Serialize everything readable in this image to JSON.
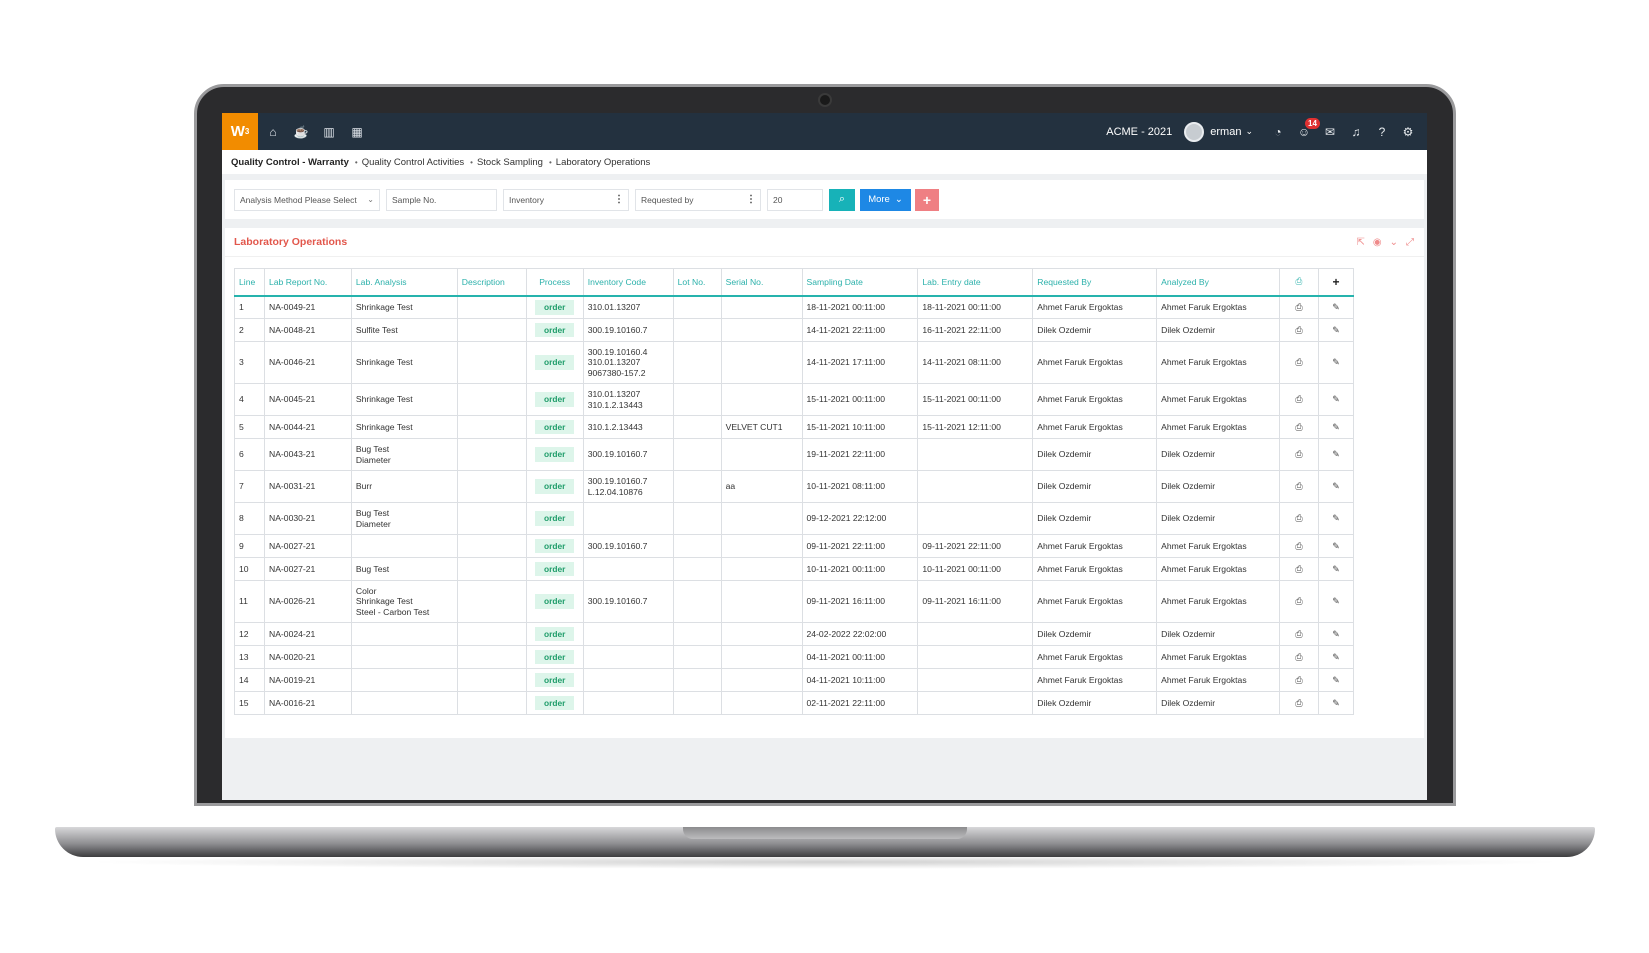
{
  "topbar": {
    "logo": "W",
    "logo_sup": "3",
    "company": "ACME - 2021",
    "username": "erman",
    "notification_count": "14"
  },
  "breadcrumb": [
    "Quality Control - Warranty",
    "Quality Control Activities",
    "Stock Sampling",
    "Laboratory Operations"
  ],
  "filters": {
    "analysis_method": "Analysis Method Please Select",
    "sample_no": "Sample No.",
    "inventory": "Inventory",
    "requested_by": "Requested by",
    "page_size": "20",
    "more_label": "More",
    "add_label": "+"
  },
  "panel": {
    "title": "Laboratory Operations"
  },
  "table": {
    "headers": [
      "Line",
      "Lab Report No.",
      "Lab. Analysis",
      "Description",
      "Process",
      "Inventory Code",
      "Lot No.",
      "Serial No.",
      "Sampling Date",
      "Lab. Entry date",
      "Requested By",
      "Analyzed By",
      "",
      "+"
    ],
    "rows": [
      {
        "line": "1",
        "report": "NA-0049-21",
        "analysis": [
          "Shrinkage Test"
        ],
        "desc": "",
        "process": "order",
        "inv": [
          "310.01.13207"
        ],
        "lot": "",
        "serial": "",
        "sampling": "18-11-2021 00:11:00",
        "entry": "18-11-2021 00:11:00",
        "req": "Ahmet Faruk Ergoktas",
        "ana": "Ahmet Faruk Ergoktas"
      },
      {
        "line": "2",
        "report": "NA-0048-21",
        "analysis": [
          "Sulfite Test"
        ],
        "desc": "",
        "process": "order",
        "inv": [
          "300.19.10160.7"
        ],
        "lot": "",
        "serial": "",
        "sampling": "14-11-2021 22:11:00",
        "entry": "16-11-2021 22:11:00",
        "req": "Dilek Ozdemir",
        "ana": "Dilek Ozdemir"
      },
      {
        "line": "3",
        "report": "NA-0046-21",
        "analysis": [
          "Shrinkage Test"
        ],
        "desc": "",
        "process": "order",
        "inv": [
          "300.19.10160.4",
          "310.01.13207",
          "9067380-157.2"
        ],
        "lot": "",
        "serial": "",
        "sampling": "14-11-2021 17:11:00",
        "entry": "14-11-2021 08:11:00",
        "req": "Ahmet Faruk Ergoktas",
        "ana": "Ahmet Faruk Ergoktas"
      },
      {
        "line": "4",
        "report": "NA-0045-21",
        "analysis": [
          "Shrinkage Test"
        ],
        "desc": "",
        "process": "order",
        "inv": [
          "310.01.13207",
          "310.1.2.13443"
        ],
        "lot": "",
        "serial": "",
        "sampling": "15-11-2021 00:11:00",
        "entry": "15-11-2021 00:11:00",
        "req": "Ahmet Faruk Ergoktas",
        "ana": "Ahmet Faruk Ergoktas"
      },
      {
        "line": "5",
        "report": "NA-0044-21",
        "analysis": [
          "Shrinkage Test"
        ],
        "desc": "",
        "process": "order",
        "inv": [
          "310.1.2.13443"
        ],
        "lot": "",
        "serial": "VELVET CUT1",
        "sampling": "15-11-2021 10:11:00",
        "entry": "15-11-2021 12:11:00",
        "req": "Ahmet Faruk Ergoktas",
        "ana": "Ahmet Faruk Ergoktas"
      },
      {
        "line": "6",
        "report": "NA-0043-21",
        "analysis": [
          "Bug Test",
          "Diameter"
        ],
        "desc": "",
        "process": "order",
        "inv": [
          "300.19.10160.7"
        ],
        "lot": "",
        "serial": "",
        "sampling": "19-11-2021 22:11:00",
        "entry": "",
        "req": "Dilek Ozdemir",
        "ana": "Dilek Ozdemir"
      },
      {
        "line": "7",
        "report": "NA-0031-21",
        "analysis": [
          "Burr"
        ],
        "desc": "",
        "process": "order",
        "inv": [
          "300.19.10160.7",
          "L.12.04.10876"
        ],
        "lot": "",
        "serial": "aa",
        "sampling": "10-11-2021 08:11:00",
        "entry": "",
        "req": "Dilek Ozdemir",
        "ana": "Dilek Ozdemir"
      },
      {
        "line": "8",
        "report": "NA-0030-21",
        "analysis": [
          "Bug Test",
          "Diameter"
        ],
        "desc": "",
        "process": "order",
        "inv": [],
        "lot": "",
        "serial": "",
        "sampling": "09-12-2021 22:12:00",
        "entry": "",
        "req": "Dilek Ozdemir",
        "ana": "Dilek Ozdemir"
      },
      {
        "line": "9",
        "report": "NA-0027-21",
        "analysis": [],
        "desc": "",
        "process": "order",
        "inv": [
          "300.19.10160.7"
        ],
        "lot": "",
        "serial": "",
        "sampling": "09-11-2021 22:11:00",
        "entry": "09-11-2021 22:11:00",
        "req": "Ahmet Faruk Ergoktas",
        "ana": "Ahmet Faruk Ergoktas"
      },
      {
        "line": "10",
        "report": "NA-0027-21",
        "analysis": [
          "Bug Test"
        ],
        "desc": "",
        "process": "order",
        "inv": [],
        "lot": "",
        "serial": "",
        "sampling": "10-11-2021 00:11:00",
        "entry": "10-11-2021 00:11:00",
        "req": "Ahmet Faruk Ergoktas",
        "ana": "Ahmet Faruk Ergoktas"
      },
      {
        "line": "11",
        "report": "NA-0026-21",
        "analysis": [
          "Color",
          "Shrinkage Test",
          "Steel - Carbon Test"
        ],
        "desc": "",
        "process": "order",
        "inv": [
          "300.19.10160.7"
        ],
        "lot": "",
        "serial": "",
        "sampling": "09-11-2021 16:11:00",
        "entry": "09-11-2021 16:11:00",
        "req": "Ahmet Faruk Ergoktas",
        "ana": "Ahmet Faruk Ergoktas"
      },
      {
        "line": "12",
        "report": "NA-0024-21",
        "analysis": [],
        "desc": "",
        "process": "order",
        "inv": [],
        "lot": "",
        "serial": "",
        "sampling": "24-02-2022 22:02:00",
        "entry": "",
        "req": "Dilek Ozdemir",
        "ana": "Dilek Ozdemir"
      },
      {
        "line": "13",
        "report": "NA-0020-21",
        "analysis": [],
        "desc": "",
        "process": "order",
        "inv": [],
        "lot": "",
        "serial": "",
        "sampling": "04-11-2021 00:11:00",
        "entry": "",
        "req": "Ahmet Faruk Ergoktas",
        "ana": "Ahmet Faruk Ergoktas"
      },
      {
        "line": "14",
        "report": "NA-0019-21",
        "analysis": [],
        "desc": "",
        "process": "order",
        "inv": [],
        "lot": "",
        "serial": "",
        "sampling": "04-11-2021 10:11:00",
        "entry": "",
        "req": "Ahmet Faruk Ergoktas",
        "ana": "Ahmet Faruk Ergoktas"
      },
      {
        "line": "15",
        "report": "NA-0016-21",
        "analysis": [],
        "desc": "",
        "process": "order",
        "inv": [],
        "lot": "",
        "serial": "",
        "sampling": "02-11-2021 22:11:00",
        "entry": "",
        "req": "Dilek Ozdemir",
        "ana": "Dilek Ozdemir"
      }
    ]
  },
  "colors": {
    "accent_teal": "#2cb1ab",
    "title_red": "#e2574c",
    "more_blue": "#1e88e5",
    "logo_orange": "#f28c00",
    "topbar_dark": "#23313f"
  }
}
